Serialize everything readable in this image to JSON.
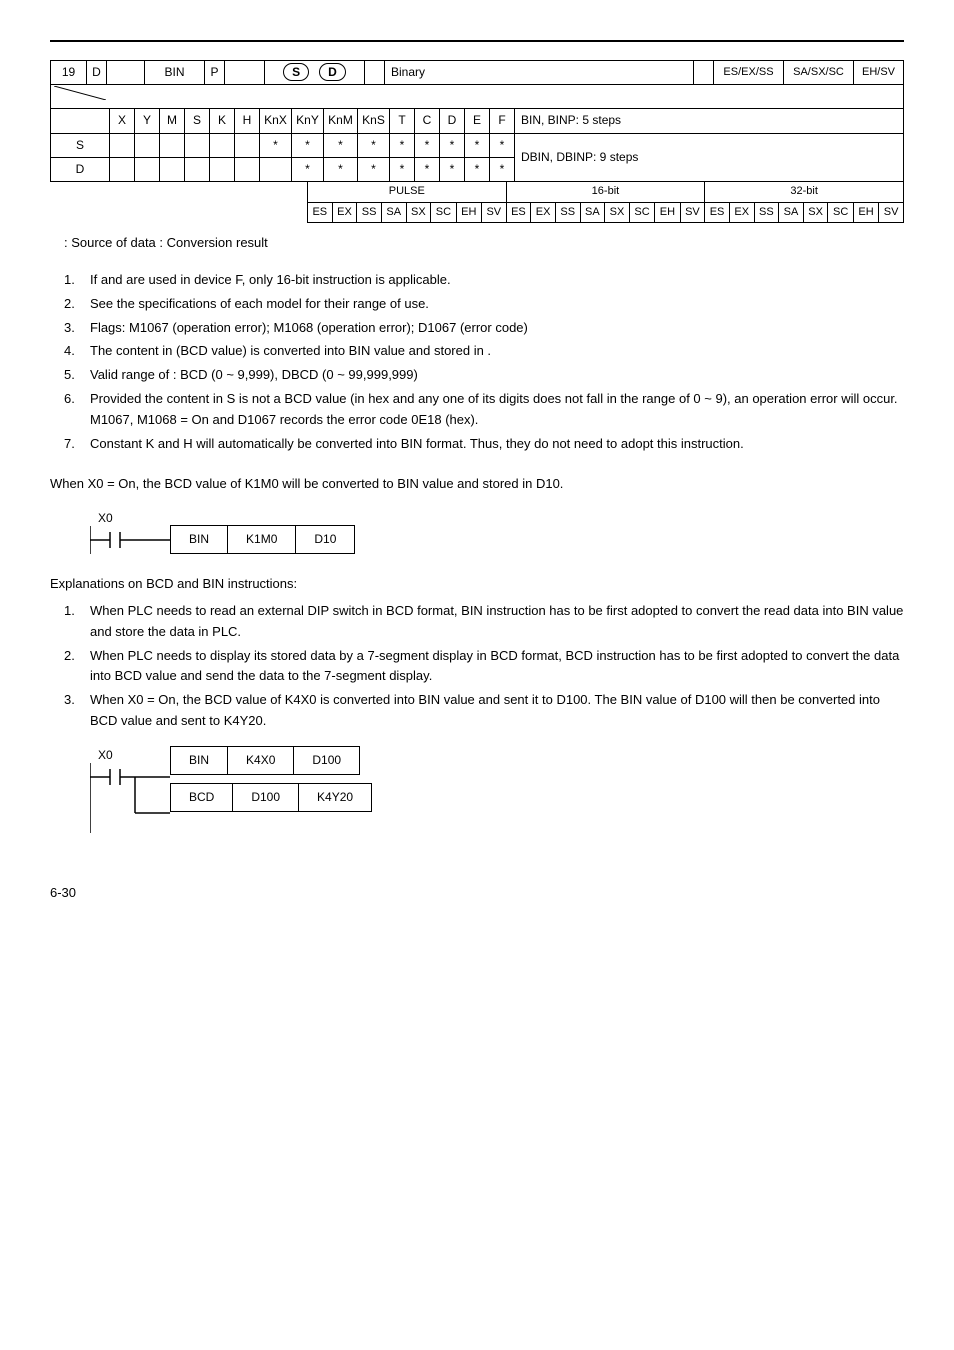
{
  "api_table": {
    "top": {
      "api_no": "19",
      "d_flag": "D",
      "mnemonic": "BIN",
      "p_flag": "P",
      "operand1": "S",
      "operand2": "D",
      "function": "Binary",
      "controllers": [
        "ES/EX/SS",
        "SA/SX/SC",
        "EH/SV"
      ]
    },
    "type_header": [
      "X",
      "Y",
      "M",
      "S",
      "K",
      "H",
      "KnX",
      "KnY",
      "KnM",
      "KnS",
      "T",
      "C",
      "D",
      "E",
      "F"
    ],
    "notes": {
      "bin": "BIN, BINP: 5 steps",
      "dbin": "DBIN, DBINP: 9 steps"
    },
    "row_s_label": "S",
    "row_d_label": "D",
    "row_s_marks": [
      "",
      "",
      "",
      "",
      "",
      "",
      "*",
      "*",
      "*",
      "*",
      "*",
      "*",
      "*",
      "*",
      "*"
    ],
    "row_d_marks": [
      "",
      "",
      "",
      "",
      "",
      "",
      "",
      "*",
      "*",
      "*",
      "*",
      "*",
      "*",
      "*",
      "*"
    ],
    "pulse_label": "PULSE",
    "bit16_label": "16-bit",
    "bit32_label": "32-bit",
    "modes_cells": [
      "ES",
      "EX",
      "SS",
      "SA",
      "SX",
      "SC",
      "EH",
      "SV",
      "ES",
      "EX",
      "SS",
      "SA",
      "SX",
      "SC",
      "EH",
      "SV",
      "ES",
      "EX",
      "SS",
      "SA",
      "SX",
      "SC",
      "EH",
      "SV"
    ]
  },
  "src_line": ": Source of data     : Conversion result",
  "explanations": [
    "If   and   are used in device F, only 16-bit instruction is applicable.",
    "See the specifications of each model for their range of use.",
    "Flags: M1067 (operation error); M1068 (operation error); D1067 (error code)",
    "The content in   (BCD value) is converted into BIN value and stored in  .",
    "Valid range of   : BCD (0 ~ 9,999), DBCD (0 ~ 99,999,999)",
    "Provided the content in S is not a BCD value (in hex and any one of its digits does not fall in the range of 0 ~ 9), an operation error will occur. M1067, M1068 = On and D1067 records the error code 0E18 (hex).",
    "Constant K and H will automatically be converted into BIN format. Thus, they do not need to adopt this instruction."
  ],
  "program_caption": "When X0 = On, the BCD value of K1M0 will be converted to BIN value and stored in D10.",
  "ladder1": {
    "contact": "X0",
    "op": "BIN",
    "src": "K1M0",
    "dst": "D10"
  },
  "remarks_heading": "Explanations on BCD and BIN instructions:",
  "remarks": [
    "When PLC needs to read an external DIP switch in BCD format, BIN instruction has to be first adopted to convert the read data into BIN value and store the data in PLC.",
    "When PLC needs to display its stored data by a 7-segment display in BCD format, BCD instruction has to be first adopted to convert the data into BCD value and send the data to the 7-segment display.",
    "When X0 = On, the BCD value of K4X0 is converted into BIN value and sent it to D100. The BIN value of D100 will then be converted into BCD value and sent to K4Y20."
  ],
  "ladder2": {
    "contact": "X0",
    "row1": {
      "op": "BIN",
      "src": "K4X0",
      "dst": "D100"
    },
    "row2": {
      "op": "BCD",
      "src": "D100",
      "dst": "K4Y20"
    }
  },
  "footer": "6-30"
}
